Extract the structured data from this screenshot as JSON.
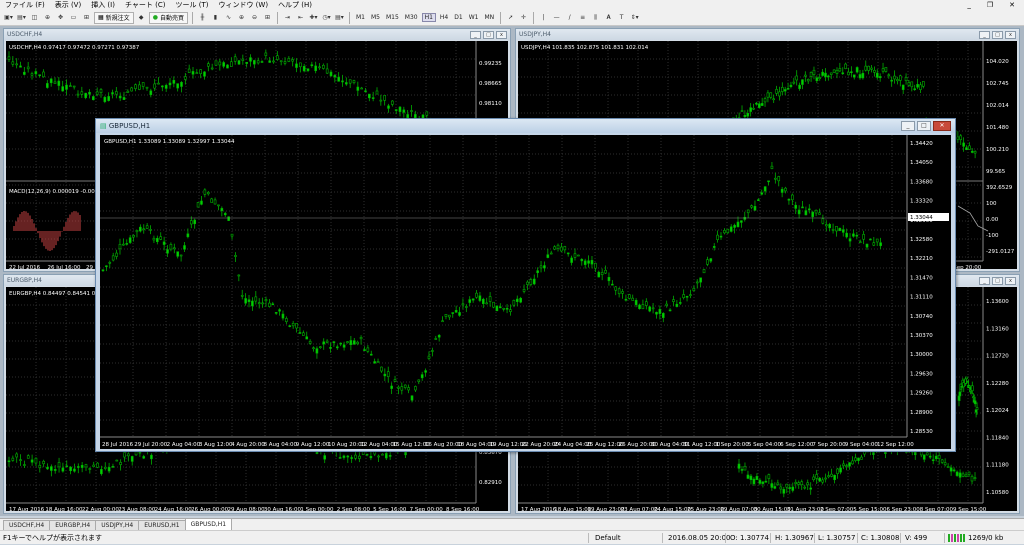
{
  "menu": [
    "ファイル (F)",
    "表示 (V)",
    "挿入 (I)",
    "チャート (C)",
    "ツール (T)",
    "ウィンドウ (W)",
    "ヘルプ (H)"
  ],
  "toolbar": {
    "new_order": "新規注文",
    "auto_trade": "自動売買",
    "timeframes": [
      "M1",
      "M5",
      "M15",
      "M30",
      "H1",
      "H4",
      "D1",
      "W1",
      "MN"
    ],
    "active_tf": "H1",
    "draw_tools": [
      "—",
      "|",
      "/",
      "≡",
      "𝐀",
      "T"
    ]
  },
  "windows": {
    "usdchf": {
      "title": "USDCHF,H4",
      "info": "USDCHF,H4  0.97417 0.97472 0.97271 0.97387",
      "prices": [
        "0.99235",
        "0.98665",
        "0.98110",
        "0.97555"
      ],
      "macd": "MACD(12,26,9) 0.000019 -0.000430",
      "dates": [
        "22 Jul 2016",
        "26 Jul 16:00",
        "29 Jul 08"
      ]
    },
    "usdjpy": {
      "title": "USDJPY,H4",
      "info": "USDJPY,H4  101.835 102.875 101.831 102.014",
      "prices": [
        "104.020",
        "102.745",
        "102.014",
        "101.480",
        "100.210",
        "99.565"
      ],
      "osc": [
        "392.6529",
        "100",
        "0.00",
        "-100",
        "-291.0127"
      ],
      "dates": [
        "9 Sep 20:00"
      ]
    },
    "eurgbp": {
      "title": "EURGBP,H4",
      "info": "EURGBP,H4  0.84497 0.84541 0.84",
      "prices": [
        "0.83670",
        "0.82910"
      ],
      "dates": [
        "17 Aug 2016",
        "18 Aug 16:00",
        "22 Aug 00:00",
        "23 Aug 08:00",
        "24 Aug 16:00",
        "26 Aug 00:00",
        "29 Aug 08:00",
        "30 Aug 16:00",
        "1 Sep 00:00",
        "2 Sep 08:00",
        "5 Sep 16:00",
        "7 Sep 00:00",
        "8 Sep 16:00"
      ]
    },
    "eurusd": {
      "prices": [
        "1.13600",
        "1.13160",
        "1.12720",
        "1.12280",
        "1.12024",
        "1.11840",
        "1.11180",
        "1.10580"
      ],
      "dates": [
        "17 Aug 2016",
        "18 Aug 15:00",
        "19 Aug 23:00",
        "23 Aug 07:00",
        "24 Aug 15:00",
        "25 Aug 23:00",
        "29 Aug 07:00",
        "30 Aug 15:00",
        "31 Aug 23:00",
        "2 Sep 07:00",
        "5 Sep 15:00",
        "6 Sep 23:00",
        "8 Sep 07:00",
        "9 Sep 15:00"
      ]
    },
    "gbpusd": {
      "title": "GBPUSD,H1",
      "info": "GBPUSD,H1  1.33089 1.33089 1.32997 1.33044",
      "current": "1.33044",
      "price_labels": [
        "1.34420",
        "1.34050",
        "1.33680",
        "1.33320",
        "1.32950",
        "1.32580",
        "1.32210",
        "1.31470",
        "1.31110",
        "1.30740",
        "1.30370",
        "1.30000",
        "1.29630",
        "1.29260",
        "1.28900",
        "1.28530"
      ],
      "dates": [
        "28 Jul 2016",
        "29 Jul 20:00",
        "2 Aug 04:00",
        "3 Aug 12:00",
        "4 Aug 20:00",
        "8 Aug 04:00",
        "9 Aug 12:00",
        "10 Aug 20:00",
        "12 Aug 04:00",
        "15 Aug 12:00",
        "16 Aug 20:00",
        "18 Aug 04:00",
        "19 Aug 12:00",
        "22 Aug 20:00",
        "24 Aug 04:00",
        "25 Aug 12:00",
        "26 Aug 20:00",
        "30 Aug 04:00",
        "31 Aug 12:00",
        "1 Sep 20:00",
        "5 Sep 04:00",
        "6 Sep 12:00",
        "7 Sep 20:00",
        "9 Sep 04:00",
        "12 Sep 12:00"
      ]
    }
  },
  "tabs": [
    "USDCHF,H4",
    "EURGBP,H4",
    "USDJPY,H4",
    "EURUSD,H1",
    "GBPUSD,H1"
  ],
  "active_tab": "GBPUSD,H1",
  "status": {
    "help": "F1キーでヘルプが表示されます",
    "profile": "Default",
    "datetime": "2016.08.05 20:00",
    "open": "O: 1.30774",
    "high": "H: 1.30967",
    "low": "L: 1.30757",
    "close": "C: 1.30808",
    "volume": "V: 499",
    "traffic": "1269/0 kb"
  },
  "colors": {
    "candle": "#00b000",
    "grid": "#3a3a3a",
    "text": "#ffffff",
    "bg": "#000000"
  }
}
